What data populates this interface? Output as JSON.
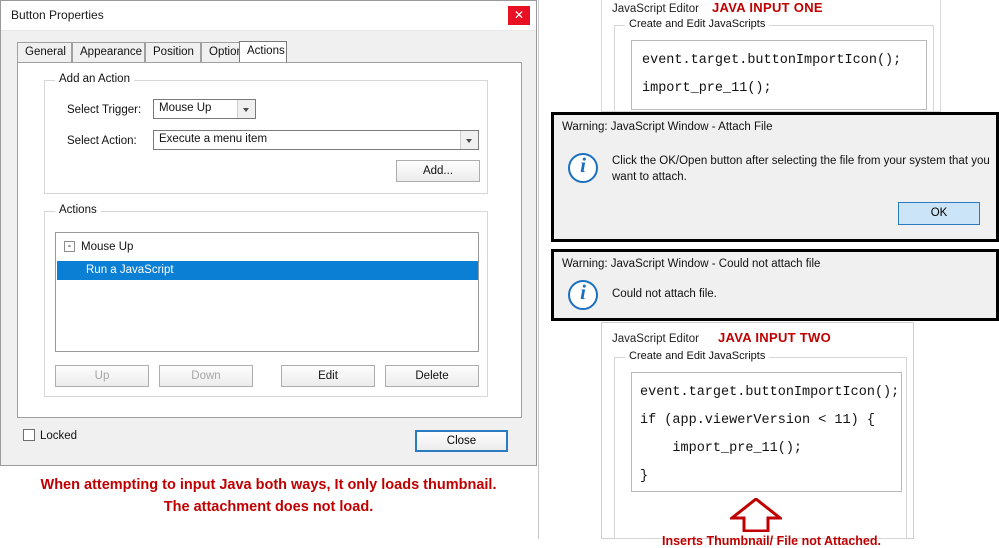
{
  "dialog": {
    "title": "Button Properties",
    "close_icon": "close-icon",
    "tabs": [
      {
        "label": "General"
      },
      {
        "label": "Appearance"
      },
      {
        "label": "Position"
      },
      {
        "label": "Options"
      },
      {
        "label": "Actions"
      }
    ],
    "active_tab": "Actions",
    "add_action": {
      "group_label": "Add an Action",
      "trigger_label": "Select Trigger:",
      "trigger_value": "Mouse Up",
      "action_label": "Select Action:",
      "action_value": "Execute a menu item",
      "add_button": "Add..."
    },
    "actions": {
      "group_label": "Actions",
      "tree_root": "Mouse Up",
      "tree_expander": "-",
      "selected_item": "Run a JavaScript",
      "buttons": {
        "up": "Up",
        "down": "Down",
        "edit": "Edit",
        "delete": "Delete"
      }
    },
    "locked_label": "Locked",
    "close_button": "Close"
  },
  "caption": {
    "line1": "When attempting to input Java both ways, It only loads thumbnail.",
    "line2": "The attachment does not load."
  },
  "js_editor_one": {
    "title": "JavaScript Editor",
    "red_label": "JAVA INPUT ONE",
    "group_label": "Create and Edit JavaScripts",
    "code_lines": [
      "event.target.buttonImportIcon();",
      "import_pre_11();"
    ]
  },
  "warning_attach": {
    "title": "Warning: JavaScript Window - Attach File",
    "icon": "info-icon",
    "message": "Click the OK/Open button after selecting the file from your system that you want to attach.",
    "ok_button": "OK"
  },
  "warning_could_not": {
    "title": "Warning: JavaScript Window - Could not attach file",
    "icon": "info-icon",
    "message": "Could not attach file."
  },
  "js_editor_two": {
    "title": "JavaScript Editor",
    "red_label": "JAVA INPUT TWO",
    "group_label": "Create and Edit JavaScripts",
    "code_lines": [
      "event.target.buttonImportIcon();",
      "if (app.viewerVersion < 11) {",
      "    import_pre_11();",
      "}"
    ],
    "annotation": "Inserts Thumbnail/ File not Attached.",
    "arrow_icon": "arrow-up-icon"
  },
  "colors": {
    "accent_blue": "#0b7fd4",
    "red_text": "#c00000",
    "close_red": "#e81123",
    "info_blue": "#1b6fc0"
  }
}
